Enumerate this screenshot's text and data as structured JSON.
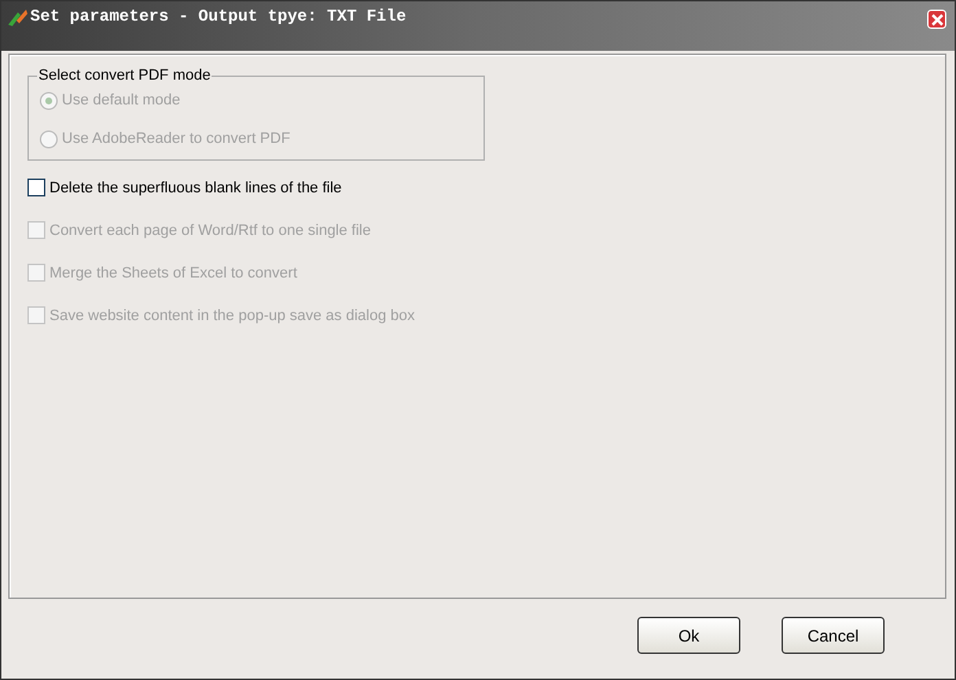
{
  "window": {
    "title": "Set parameters - Output tpye: TXT File"
  },
  "pdf_mode": {
    "label": "Select convert PDF mode",
    "options": [
      {
        "label": "Use default mode",
        "selected": true,
        "disabled": true
      },
      {
        "label": "Use AdobeReader to convert PDF",
        "selected": false,
        "disabled": true
      }
    ]
  },
  "options": [
    {
      "label": "Delete the superfluous blank lines of the file",
      "checked": false,
      "disabled": false
    },
    {
      "label": "Convert each page of Word/Rtf to one single file",
      "checked": false,
      "disabled": true
    },
    {
      "label": "Merge the Sheets of Excel to convert",
      "checked": false,
      "disabled": true
    },
    {
      "label": "Save website content in the pop-up save as dialog box",
      "checked": false,
      "disabled": true
    }
  ],
  "buttons": [
    "Ok",
    "Cancel"
  ]
}
